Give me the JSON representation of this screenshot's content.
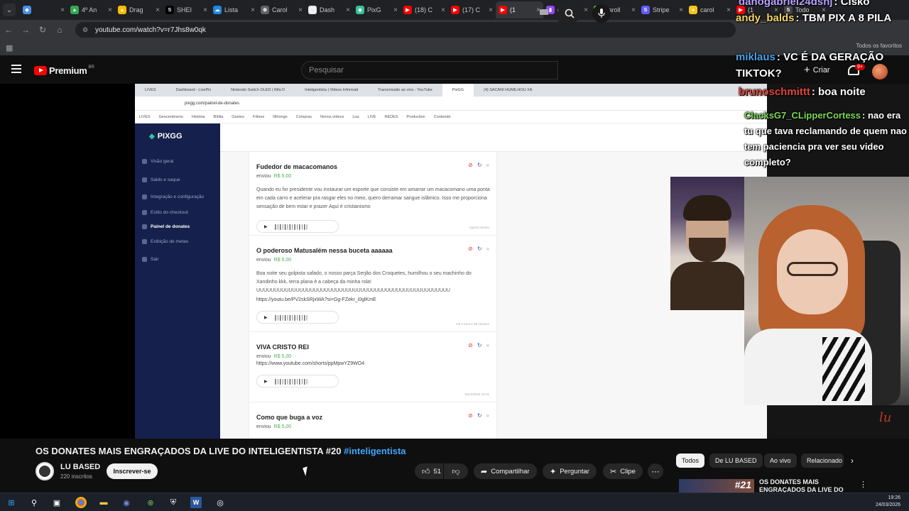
{
  "browser": {
    "tabs": [
      {
        "label": "",
        "fav_color": "#4a90e2",
        "fav_char": "◆"
      },
      {
        "label": "4º An",
        "fav_color": "#34a853",
        "fav_char": "▲"
      },
      {
        "label": "Drag",
        "fav_color": "#fbbc04",
        "fav_char": "▲"
      },
      {
        "label": "SHEI",
        "fav_color": "#000000",
        "fav_char": "S"
      },
      {
        "label": "Lista",
        "fav_color": "#1e88e5",
        "fav_char": "☁"
      },
      {
        "label": "Carol",
        "fav_color": "#5f6368",
        "fav_char": "⊕"
      },
      {
        "label": "Dash",
        "fav_color": "#e8eaed",
        "fav_char": "◯"
      },
      {
        "label": "PixG",
        "fav_color": "#35c29a",
        "fav_char": "◆"
      },
      {
        "label": "(18) C",
        "fav_color": "#ff0000",
        "fav_char": "▶"
      },
      {
        "label": "(17) C",
        "fav_color": "#ff0000",
        "fav_char": "▶"
      },
      {
        "label": "(1",
        "fav_color": "#ff0000",
        "fav_char": "▶",
        "active": true
      },
      {
        "label": "caroll",
        "fav_color": "#9146ff",
        "fav_char": "▮"
      },
      {
        "label": "caroll",
        "fav_color": "#53fc18",
        "fav_char": "K"
      },
      {
        "label": "Stripe",
        "fav_color": "#635bff",
        "fav_char": "S"
      },
      {
        "label": "carol",
        "fav_color": "#f5c518",
        "fav_char": "●"
      },
      {
        "label": "(1",
        "fav_color": "#ff0000",
        "fav_char": "▶"
      },
      {
        "label": "Todo",
        "fav_color": "#444444",
        "fav_char": "S"
      }
    ],
    "url": "youtube.com/watch?v=r7Jhs8w0qk",
    "all_bookmarks": "Todos os favoritos"
  },
  "youtube": {
    "logo_word": "Premium",
    "region": "BR",
    "search_placeholder": "Pesquisar",
    "create_label": "Criar",
    "notif_count": "9+"
  },
  "inner_page": {
    "tabs": [
      "LIVES",
      "Dashboard - LivePix",
      "Nintendo Switch OLED | Rifa D",
      "Inteligentista | Videos Informati",
      "Transmissão ao vivo - YouTube",
      "PixGG",
      "(4) SACANI HUMILHOU XA"
    ],
    "url": "pixgg.com/painel-de-donates",
    "bookmarks": [
      "LIVES",
      "Geocentrismo",
      "História",
      "Bíblia",
      "Games",
      "Filmes",
      "Nihongo",
      "Compras",
      "Novos vídeos",
      "Lua",
      "LIVE",
      "REDES",
      "Production",
      "Conteúdo"
    ],
    "logo": "PIXGG",
    "sidebar": [
      "Visão geral",
      "Saldo e saque",
      "Integração e configuração",
      "Estilo do checkout",
      "Painel de donates",
      "Exibição de metas",
      "Sair"
    ],
    "donations": [
      {
        "title": "Fudedor de macacomanos",
        "sent": "enviou",
        "amount": "R$ 5,00",
        "message": "Quando eu for presidente vou instaurar um esporte que consiste em amarrar um macacomano uma ponta em cada carro e acelerar pra rasgar eles no meio, quero derramar sangue islâmico. Isso me proporciona sensação de bem estar e prazer Aqui é cristianismo",
        "link": "",
        "time": "Agora mesmo"
      },
      {
        "title": "O poderoso Matusalém nessa buceta aaaaaa",
        "sent": "enviou",
        "amount": "R$ 5,00",
        "message": "Boa noite seu golpista safado, o nosso parça Serjão dos Croquetes, humilhou o seu machinho do Xandinho kkk, terra plana é a cabeça da minha rola! UUUUUUUUUUUUUUUUUUUUUUUUUUUUUUUUUUUUUUUUUUUUUUUUUUUUUU",
        "link": "https://youtu.be/PV2skSRjxWA?si=Gg-FZekr_i0glKmE",
        "time": "Há 1 hora e 28 minutos"
      },
      {
        "title": "VIVA CRISTO REI",
        "sent": "enviou",
        "amount": "R$ 5,00",
        "message": "",
        "link": "https://www.youtube.com/shorts/ppMpwYZ9WO4",
        "time": "16/12/2024 23:31"
      },
      {
        "title": "Como que buga a voz",
        "sent": "enviou",
        "amount": "R$ 5,00",
        "message": "",
        "link": "",
        "time": ""
      }
    ]
  },
  "chat": [
    {
      "user": "danogabriel24dsnj",
      "msg": "Cisko",
      "color": "#b8a2ff"
    },
    {
      "user": "andy_balds",
      "msg": "TBM PIX A 8 PILA",
      "color": "#f2d36b"
    },
    {
      "user": "miklaus",
      "msg": "VC É DA GERAÇÃO TIKTOK?",
      "color": "#4aa3e8"
    },
    {
      "user": "brunoschmittt",
      "msg": "boa noite",
      "color": "#e0443a"
    },
    {
      "user": "ClacksG7_CLipperCortess",
      "msg": "nao era tu que tava reclamando de quem nao tem paciencia pra ver seu video completo?",
      "color": "#7ad957"
    }
  ],
  "video": {
    "title": "OS DONATES MAIS ENGRAÇADOS DA LIVE DO INTELIGENTISTA #20",
    "hashtag": "#inteligentista",
    "channel": "LU BASED",
    "subs": "220 inscritos",
    "subscribe": "Inscrever-se",
    "likes": "51",
    "share": "Compartilhar",
    "ask": "Perguntar",
    "clip": "Clipe",
    "watermark": "lu"
  },
  "chips": [
    "Todos",
    "De LU BASED",
    "Ao vivo",
    "Relacionado"
  ],
  "recommendation": {
    "title": "OS DONATES MAIS ENGRAÇADOS DA LIVE DO INTELIGENTISTA",
    "thumb_num": "#21"
  },
  "taskbar": {
    "time": "19:26",
    "date": "24/03/2026"
  }
}
